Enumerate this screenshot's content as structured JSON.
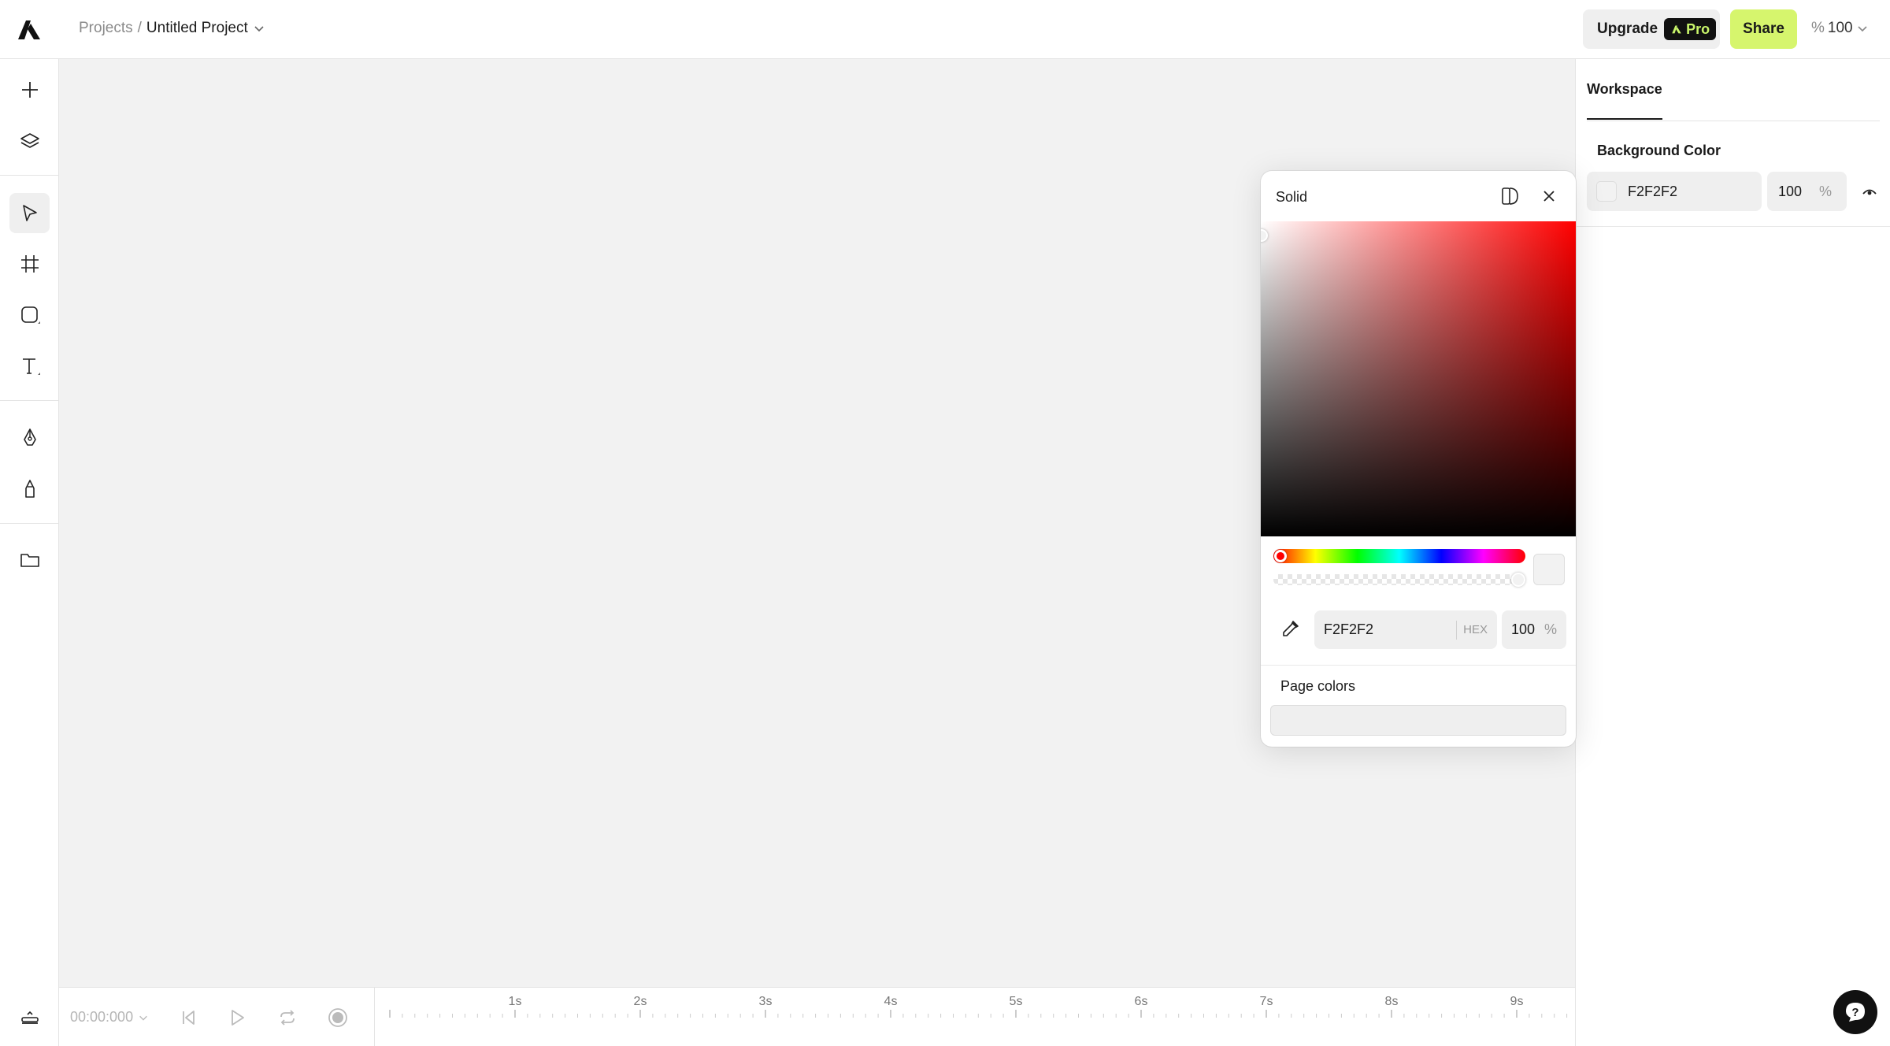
{
  "breadcrumb": {
    "root": "Projects",
    "separator": "/",
    "current": "Untitled Project"
  },
  "header": {
    "upgrade_label": "Upgrade",
    "pro_label": "Pro",
    "share_label": "Share",
    "zoom_prefix": "%",
    "zoom_value": "100"
  },
  "toolbar": {
    "tools": [
      "add-icon",
      "layers-icon",
      "select-icon",
      "frame-icon",
      "shape-icon",
      "text-icon",
      "pen-icon",
      "pencil-icon",
      "folder-icon"
    ],
    "active_tool": "select-icon"
  },
  "right_panel": {
    "tab": "Workspace",
    "background_label": "Background Color",
    "background_hex": "F2F2F2",
    "background_opacity": "100",
    "opacity_unit": "%"
  },
  "color_picker": {
    "mode": "Solid",
    "hue_color": "#ff0000",
    "current_color": "#f2f2f2",
    "hex_value": "F2F2F2",
    "hex_label": "HEX",
    "opacity_value": "100",
    "opacity_unit": "%",
    "page_colors_label": "Page colors"
  },
  "timeline": {
    "current_time": "00:00:000",
    "ticks": [
      "1s",
      "2s",
      "3s",
      "4s",
      "5s",
      "6s",
      "7s",
      "8s",
      "9s"
    ]
  },
  "colors": {
    "accent": "#d6f56d",
    "pro_text": "#c9f56b",
    "canvas": "#f2f2f2"
  }
}
